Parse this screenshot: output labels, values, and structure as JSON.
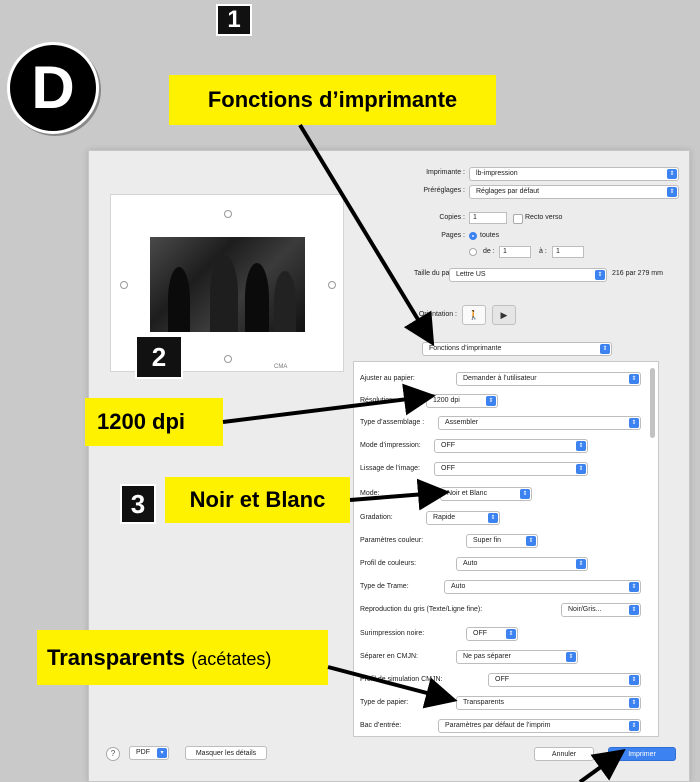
{
  "annotations": {
    "section_letter": "D",
    "step1_number": "1",
    "step1_label": "Fonctions d’imprimante",
    "step2_number": "2",
    "step2_label": "1200 dpi",
    "step3_number": "3",
    "step3_label": "Noir et Blanc",
    "transparents_label": "Transparents",
    "transparents_note": "(acétates)"
  },
  "print_dialog": {
    "printer_label": "Imprimante :",
    "printer_value": "lb-impression",
    "presets_label": "Préréglages :",
    "presets_value": "Réglages par défaut",
    "copies_label": "Copies :",
    "copies_value": "1",
    "recto_verso_label": "Recto verso",
    "pages_label": "Pages :",
    "pages_all_label": "toutes",
    "pages_from_label": "de :",
    "pages_from_value": "1",
    "pages_to_label": "à :",
    "pages_to_value": "1",
    "paper_size_label": "Taille du papier :",
    "paper_size_value": "Lettre US",
    "paper_size_dims": "216 par 279 mm",
    "orientation_label": "Orientation :",
    "section_popup": "Fonctions d’imprimante",
    "preview_caption": "CMA",
    "options": [
      {
        "label": "Ajuster au papier:",
        "value": "Demander à l’utilisateur"
      },
      {
        "label": "Résolution:",
        "value": "1200 dpi"
      },
      {
        "label": "Type d’assemblage :",
        "value": "Assembler"
      },
      {
        "label": "Mode d’impression:",
        "value": "OFF"
      },
      {
        "label": "Lissage de l’image:",
        "value": "OFF"
      },
      {
        "label": "Mode:",
        "value": "Noir et Blanc"
      },
      {
        "label": "Gradation:",
        "value": "Rapide"
      },
      {
        "label": "Paramètres couleur:",
        "value": "Super fin"
      },
      {
        "label": "Profil de couleurs:",
        "value": "Auto"
      },
      {
        "label": "Type de Trame:",
        "value": "Auto"
      },
      {
        "label": "Reproduction du gris (Texte/Ligne fine):",
        "value": "Noir/Gris..."
      },
      {
        "label": "Surimpression noire:",
        "value": "OFF"
      },
      {
        "label": "Séparer en CMJN:",
        "value": "Ne pas séparer"
      },
      {
        "label": "Profil de simulation CMJN:",
        "value": "OFF"
      },
      {
        "label": "Type de papier:",
        "value": "Transparents"
      },
      {
        "label": "Bac d’entrée:",
        "value": "Paramètres par défaut de l’imprim"
      }
    ],
    "pdf_label": "PDF",
    "hide_details_label": "Masquer les détails",
    "cancel_label": "Annuler",
    "print_label": "Imprimer",
    "help_label": "?"
  },
  "colors": {
    "callout_yellow": "#fff200",
    "accent_blue": "#3c82f0"
  }
}
